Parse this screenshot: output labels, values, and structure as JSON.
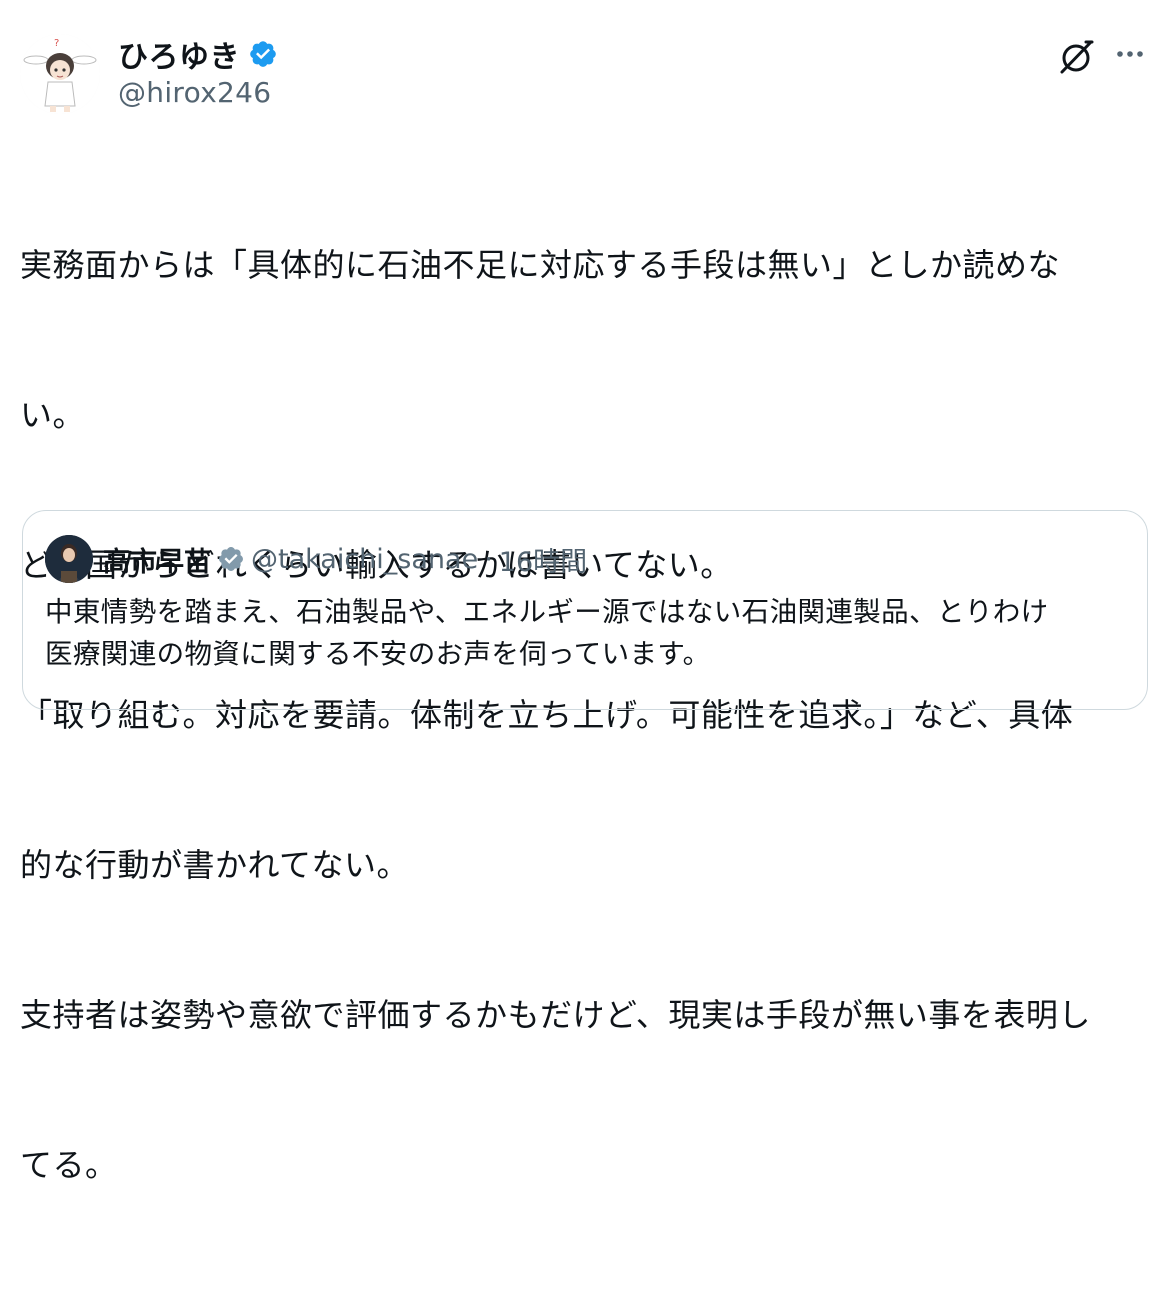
{
  "author": {
    "display_name": "ひろゆき",
    "handle": "@hirox246",
    "verified": true,
    "avatar_icon": "anime-character-avatar"
  },
  "actions": {
    "grok_icon": "grok-icon",
    "more_icon": "more-options-icon"
  },
  "tweet": {
    "lines": [
      "実務面からは「具体的に石油不足に対応する手段は無い」としか読めな",
      "い。",
      "どの国からどれくらい輸入するかは書いてない。",
      "「取り組む。対応を要請。体制を立ち上げ。可能性を追求。」など、具体",
      "的な行動が書かれてない。",
      "支持者は姿勢や意欲で評価するかもだけど、現実は手段が無い事を表明し",
      "てる。"
    ]
  },
  "quote": {
    "display_name": "高市早苗",
    "handle": "@takaichi_sanae",
    "separator": "·",
    "time": "16時間",
    "verified": true,
    "lines": [
      "中東情勢を踏まえ、石油製品や、エネルギー源ではない石油関連製品、とりわけ",
      "医療関連の物資に関する不安のお声を伺っています。"
    ]
  },
  "colors": {
    "text": "#0f1419",
    "secondary": "#536471",
    "verified_blue": "#1d9bf0",
    "verified_gray": "#829aab",
    "border": "#cfd9de"
  }
}
